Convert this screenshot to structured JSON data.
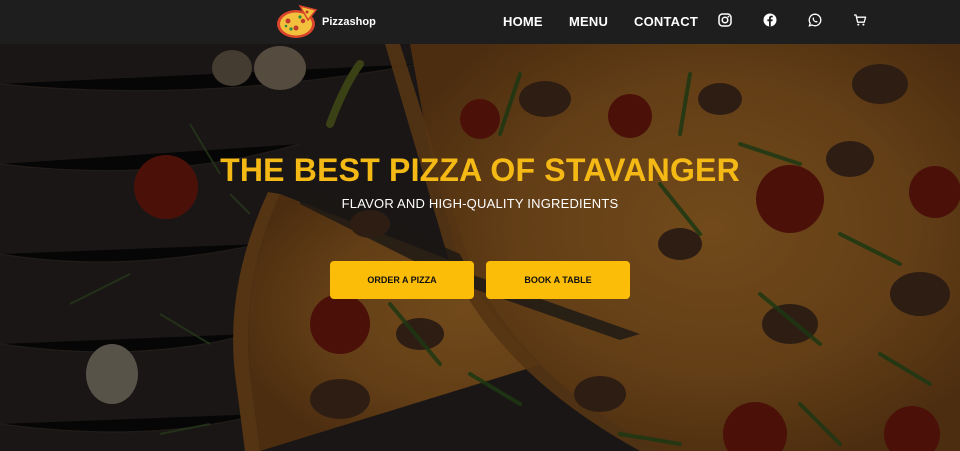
{
  "navbar": {
    "brand": "Pizzashop",
    "links": [
      "HOME",
      "MENU",
      "CONTACT"
    ],
    "icons": [
      "instagram-icon",
      "facebook-icon",
      "whatsapp-icon",
      "cart-icon"
    ]
  },
  "hero": {
    "title": "THE BEST PIZZA OF STAVANGER",
    "subtitle": "FLAVOR AND HIGH-QUALITY INGREDIENTS",
    "buttons": [
      "ORDER A PIZZA",
      "BOOK A TABLE"
    ]
  },
  "colors": {
    "navbar_bg": "#1e1e1e",
    "accent": "#fbbd08",
    "title": "#f5b915"
  }
}
